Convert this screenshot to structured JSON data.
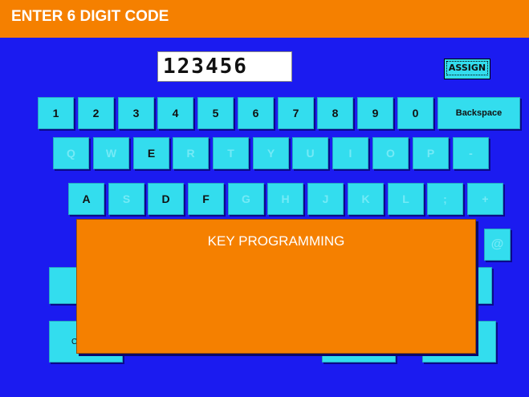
{
  "header": {
    "title": "ENTER 6 DIGIT CODE"
  },
  "code_display": {
    "value": "123456"
  },
  "assign_label": "ASSIGN",
  "keys_row1": [
    "1",
    "2",
    "3",
    "4",
    "5",
    "6",
    "7",
    "8",
    "9",
    "0"
  ],
  "backspace_label": "Backspace",
  "keys_row2": [
    "Q",
    "W",
    "E",
    "R",
    "T",
    "Y",
    "U",
    "I",
    "O",
    "P",
    "-"
  ],
  "keys_row3": [
    "A",
    "S",
    "D",
    "F",
    "G",
    "H",
    "J",
    "K",
    "L",
    ";",
    "+"
  ],
  "at_key": "@",
  "overlay": {
    "title": "KEY PROGRAMMING"
  },
  "partial_key_label": "C",
  "colors": {
    "background": "#1b1bf0",
    "header": "#f58000",
    "key": "#33ddee",
    "overlay": "#f58000"
  }
}
